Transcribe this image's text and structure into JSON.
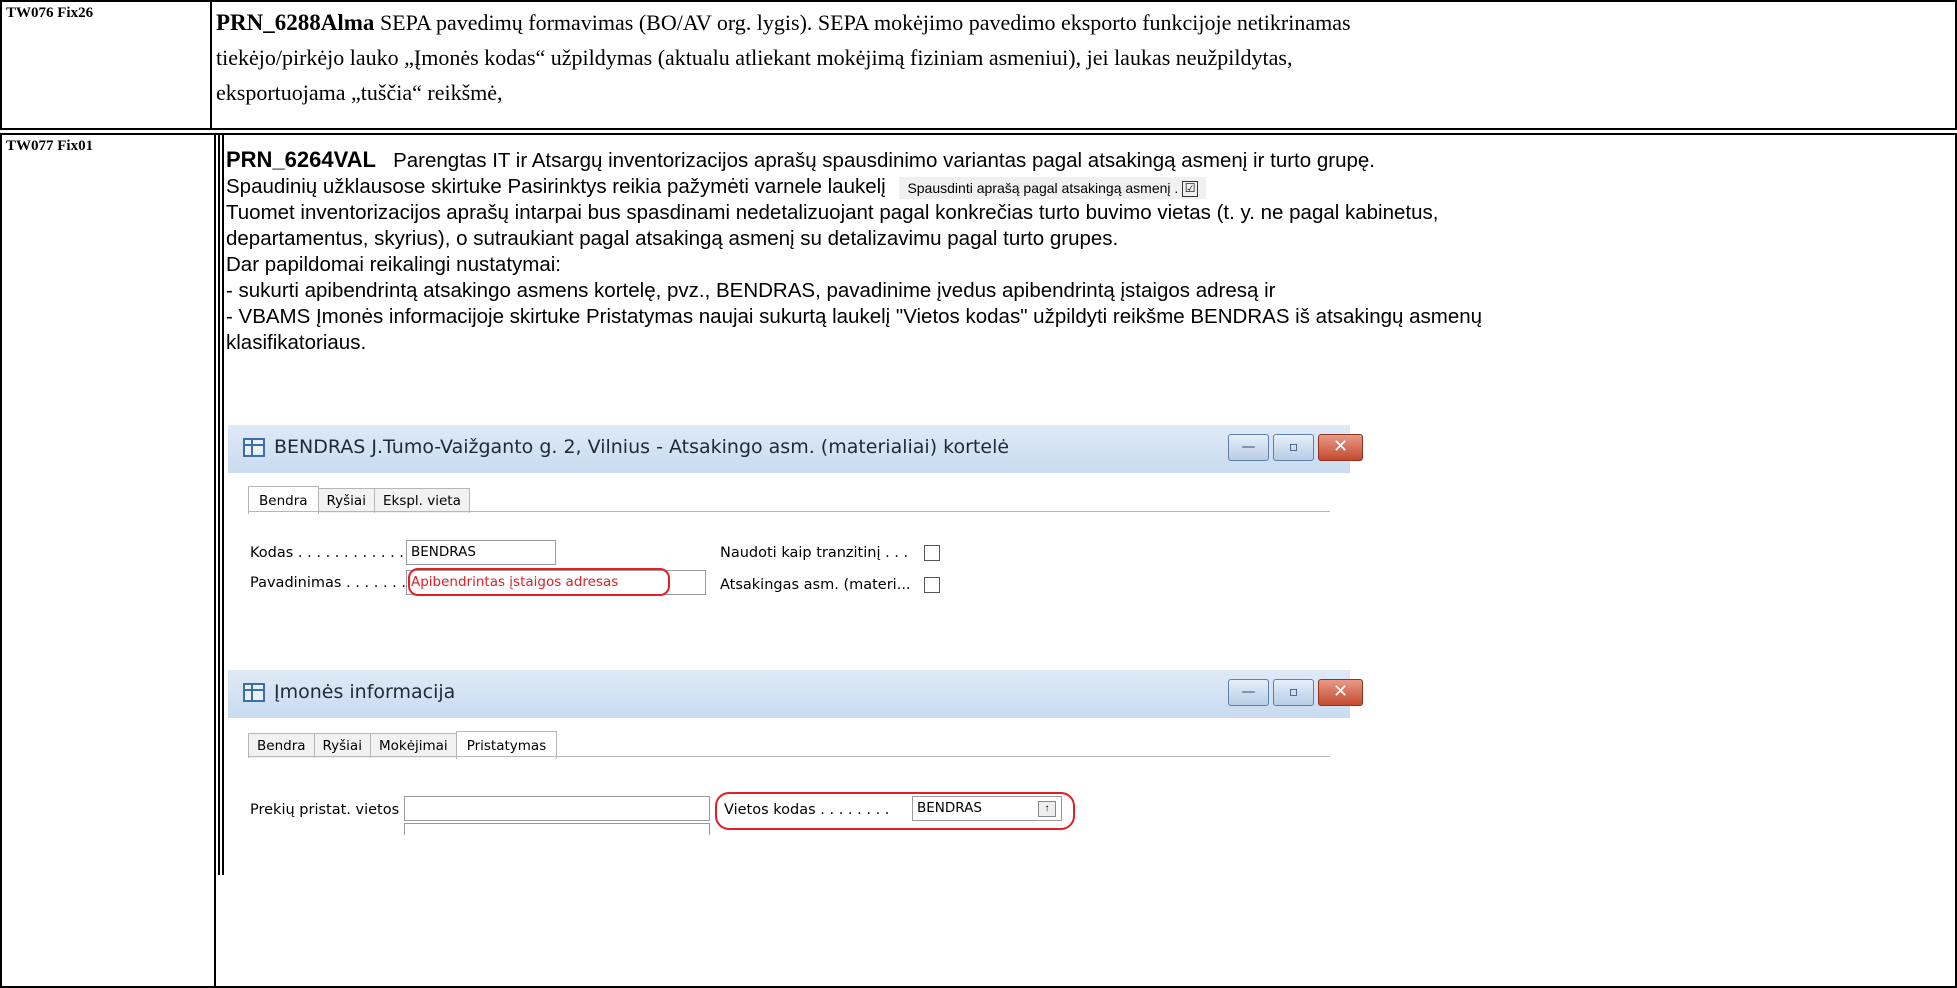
{
  "rows": [
    {
      "id": "TW076 Fix26",
      "code": "PRN_6288Alma",
      "line1_rest": "SEPA pavedimų formavimas (BO/AV org. lygis). SEPA mokėjimo pavedimo eksporto funkcijoje netikrinamas",
      "line2": "tiekėjo/pirkėjo lauko „Įmonės kodas“ užpildymas (aktualu atliekant mokėjimą fiziniam asmeniui), jei laukas neužpildytas,",
      "line3": "eksportuojama „tuščia“ reikšmė,"
    },
    {
      "id": "TW077 Fix01",
      "code": "PRN_6264VAL",
      "line1_rest": "Parengtas IT ir Atsargų inventorizacijos aprašų spausdinimo variantas pagal atsakingą asmenį ir turto grupę.",
      "line2_pre": "Spaudinių užklausose skirtuke Pasirinktys reikia pažymėti varnele laukelį",
      "option_chip": "Spausdinti aprašą pagal atsakingą asmenį",
      "option_chip_suffix": ".",
      "line3": "Tuomet inventorizacijos aprašų intarpai bus spasdinami nedetalizuojant pagal konkrečias turto buvimo vietas (t. y. ne pagal kabinetus,",
      "line4": "departamentus, skyrius), o sutraukiant pagal atsakingą asmenį su  detalizavimu pagal turto grupes.",
      "line5": "Dar papildomai reikalingi nustatymai:",
      "line6": "- sukurti apibendrintą atsakingo asmens kortelę, pvz., BENDRAS, pavadinime įvedus apibendrintą įstaigos adresą      ir",
      "line7": "- VBAMS  Įmonės informacijoje skirtuke Pristatymas naujai sukurtą laukelį \"Vietos kodas\" užpildyti reikšme BENDRAS iš atsakingų asmenų",
      "line8": "klasifikatoriaus."
    }
  ],
  "window1": {
    "title": "BENDRAS J.Tumo-Vaižganto g. 2, Vilnius - Atsakingo asm. (materialiai) kortelė",
    "tabs": [
      "Bendra",
      "Ryšiai",
      "Ekspl. vieta"
    ],
    "fields": {
      "kodas_label": "Kodas . . . . . . . . . . . .",
      "kodas_value": "BENDRAS",
      "pavadinimas_label": "Pavadinimas . . . . . . . .",
      "pavadinimas_value": "Apibendrintas įstaigos adresas",
      "tranzit_label": "Naudoti kaip tranzitinį . . .",
      "atsak_label": "Atsakingas asm. (materi..."
    }
  },
  "window2": {
    "title": "Įmonės informacija",
    "tabs": [
      "Bendra",
      "Ryšiai",
      "Mokėjimai",
      "Pristatymas"
    ],
    "fields": {
      "prekiu_label": "Prekių pristat. vietos pav. .",
      "vietos_label": "Vietos kodas . . . . . . . .",
      "vietos_value": "BENDRAS"
    }
  },
  "window_buttons": {
    "minimize": "—",
    "restore": "▫",
    "close": "✕",
    "lookup": "↑",
    "check": "☑"
  }
}
